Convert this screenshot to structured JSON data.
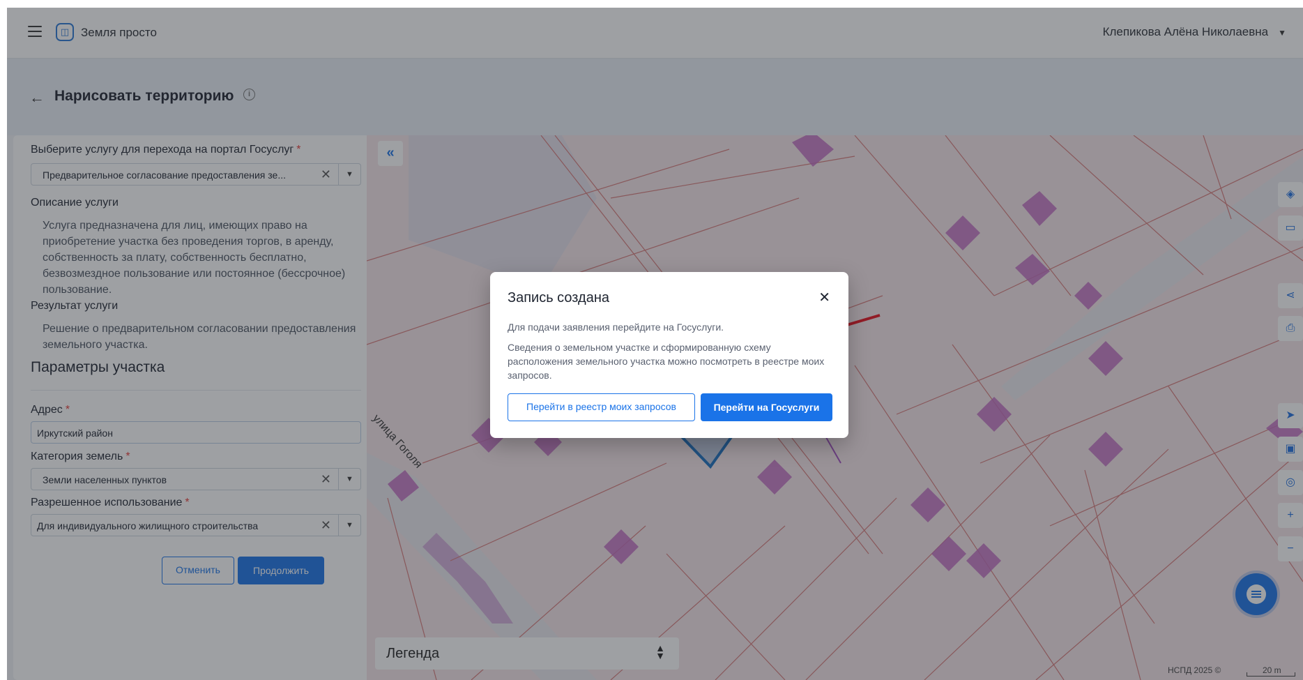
{
  "topbar": {
    "brand": "Земля просто",
    "user_name": "Клепикова Алёна Николаевна"
  },
  "header": {
    "back": "←",
    "title": "Нарисовать территорию"
  },
  "form": {
    "service_label": "Выберите услугу для перехода на портал Госуслуг",
    "service_value": "Предварительное согласование предоставления зе...",
    "description_label": "Описание услуги",
    "description_text": "Услуга предназначена для лиц, имеющих право на приобретение участка без проведения торгов, в аренду, собственность за плату, собственность бесплатно, безвозмездное пользование или постоянное (бессрочное) пользование.",
    "result_label": "Результат услуги",
    "result_text": "Решение о предварительном согласовании предоставления земельного участка.",
    "params_title": "Параметры участка",
    "address_label": "Адрес",
    "address_value": "Иркутский район",
    "category_label": "Категория земель",
    "category_value": "Земли населенных пунктов",
    "usage_label": "Разрешенное использование",
    "usage_value": "Для индивидуального жилищного строительства",
    "cancel_label": "Отменить",
    "continue_label": "Продолжить",
    "required_mark": "*",
    "clear_glyph": "✕",
    "dropdown_glyph": "▼"
  },
  "map": {
    "collapse_glyph": "«",
    "street_label": "улица Гоголя",
    "legend_label": "Легенда",
    "copyright": "НСПД 2025 ©",
    "scale_label": "20 m",
    "tools": [
      "layers-icon",
      "ruler-icon",
      "share-icon",
      "print-icon",
      "locate-icon",
      "picture-icon",
      "geo-search-icon",
      "zoom-in-icon",
      "zoom-out-icon"
    ]
  },
  "modal": {
    "title": "Запись создана",
    "close": "✕",
    "text1": "Для подачи заявления перейдите на Госуслуги.",
    "text2": "Сведения о земельном участке и сформированную схему расположения земельного участка можно посмотреть в реестре моих запросов.",
    "registry_button": "Перейти в реестр моих запросов",
    "gosuslugi_button": "Перейти на Госуслуги"
  },
  "colors": {
    "accent": "#1a73e8",
    "required": "#e53935",
    "annotation_arrow": "#e8101c",
    "parcel_outline": "#1a6fc0"
  }
}
